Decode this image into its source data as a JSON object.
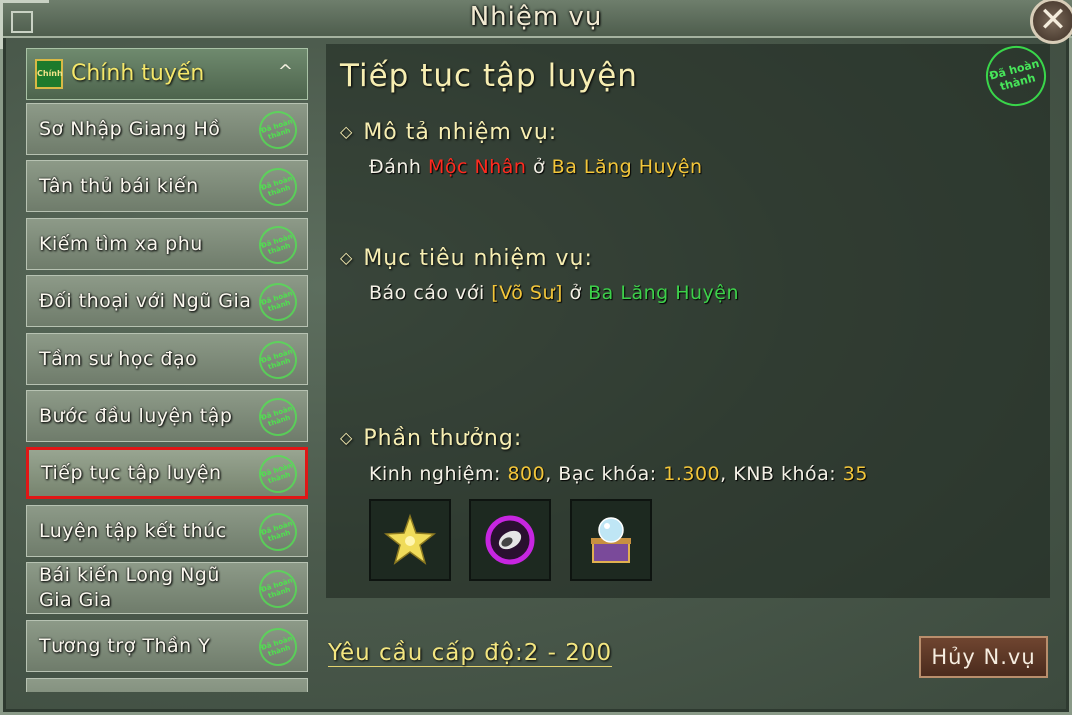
{
  "window": {
    "title": "Nhiệm vụ",
    "close_label": "✕"
  },
  "category": {
    "badge": "Chính",
    "label": "Chính tuyến",
    "chevron": "^"
  },
  "quests": [
    {
      "label": "Sơ Nhập Giang Hồ",
      "status": "Đã hoàn thành"
    },
    {
      "label": "Tân thủ bái kiến",
      "status": "Đã hoàn thành"
    },
    {
      "label": "Kiếm tìm xa phu",
      "status": "Đã hoàn thành"
    },
    {
      "label": "Đối thoại với Ngũ Gia",
      "status": "Đã hoàn thành"
    },
    {
      "label": "Tầm sư học đạo",
      "status": "Đã hoàn thành"
    },
    {
      "label": "Bước đầu luyện tập",
      "status": "Đã hoàn thành"
    },
    {
      "label": "Tiếp tục tập luyện",
      "status": "Đã hoàn thành",
      "selected": true
    },
    {
      "label": "Luyện tập kết thúc",
      "status": "Đã hoàn thành"
    },
    {
      "label": "Bái kiến Long Ngũ Gia Gia",
      "status": "Đã hoàn thành"
    },
    {
      "label": "Tương trợ Thần Y",
      "status": "Đã hoàn thành"
    }
  ],
  "detail": {
    "title": "Tiếp tục tập luyện",
    "status_stamp": "Đã hoàn thành",
    "description": {
      "heading": "Mô tả nhiệm vụ:",
      "verb": "Đánh",
      "target": "Mộc Nhân",
      "prep": "ở",
      "location": "Ba Lăng Huyện"
    },
    "objective": {
      "heading": "Mục tiêu nhiệm vụ:",
      "verb": "Báo cáo với",
      "npc": "[Võ Sư]",
      "prep": "ở",
      "location": "Ba Lăng Huyện"
    },
    "rewards": {
      "heading": "Phần thưởng:",
      "exp_label": "Kinh nghiệm:",
      "exp_value": "800",
      "silver_label": "Bạc khóa:",
      "silver_value": "1.300",
      "knb_label": "KNB khóa:",
      "knb_value": "35",
      "items": [
        {
          "icon": "star-flower-icon"
        },
        {
          "icon": "purple-orb-icon"
        },
        {
          "icon": "crystal-chest-icon"
        }
      ]
    }
  },
  "footer": {
    "level_label": "Yêu cầu cấp độ:",
    "level_value": "2 - 200",
    "cancel_label": "Hủy N.vụ"
  },
  "colors": {
    "highlight_red": "#ff2a1f",
    "value_gold": "#f3c63a",
    "location_green": "#3dd14a",
    "selection_border": "#e01616"
  }
}
